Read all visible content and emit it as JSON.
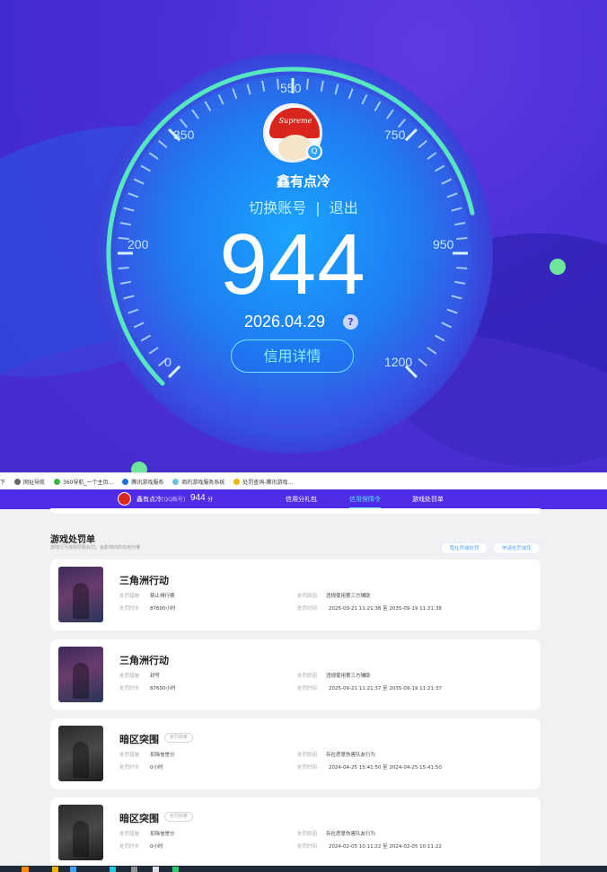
{
  "hero": {
    "username": "鑫有点冷",
    "switch_account": "切换账号",
    "separator": "|",
    "logout": "退出",
    "score": "944",
    "date": "2026.04.29",
    "help": "?",
    "detail_button": "信用详情",
    "avatar_cap_text": "Supreme",
    "gauge_labels": [
      "0",
      "200",
      "350",
      "550",
      "750",
      "950",
      "1200"
    ],
    "gauge_min": 0,
    "gauge_max": 1200,
    "colors": {
      "progress": "#57e7c0",
      "accent": "#6fe3ff",
      "background": "#4a2fd6"
    }
  },
  "bookmarks": [
    {
      "label": "下",
      "icon": "none"
    },
    {
      "label": "网址导航",
      "icon": "globe-icon",
      "color": "#666666"
    },
    {
      "label": "360导航_一个主页...",
      "icon": "360-icon",
      "color": "#3fb449"
    },
    {
      "label": "腾讯游戏服务",
      "icon": "tencent-icon",
      "color": "#1e6fd9"
    },
    {
      "label": "商的游戏服务系统",
      "icon": "service-icon",
      "color": "#6ec3d8"
    },
    {
      "label": "处罚查询-腾讯游戏...",
      "icon": "star-icon",
      "color": "#f5b400"
    }
  ],
  "navbar": {
    "username": "鑫有点冷",
    "account_tag": "[QQ账号]",
    "score": "944",
    "score_unit": "分",
    "tabs": [
      {
        "label": "信用分礼包",
        "active": false
      },
      {
        "label": "信用保障令",
        "active": true
      },
      {
        "label": "游戏处罚单",
        "active": false
      }
    ]
  },
  "penalties": {
    "title": "游戏处罚单",
    "description": "游戏行为违规导致处罚，会影响你的信用分哦",
    "buttons": [
      "我在异端处罚",
      "申请处罚减免"
    ],
    "labels": {
      "measure": "处罚措施",
      "duration": "处罚时长",
      "reason": "处罚原因",
      "time": "处罚时间"
    },
    "time_separator": "至",
    "items": [
      {
        "game": "三角洲行动",
        "tag": "",
        "measure": "禁止排行榜",
        "duration": "87600小时",
        "reason": "违规使用第三方辅助",
        "start": "2025-09-21 11:21:38",
        "end": "2035-09-19 11:21:38",
        "thumb": "purple"
      },
      {
        "game": "三角洲行动",
        "tag": "",
        "measure": "封号",
        "duration": "87600小时",
        "reason": "违规使用第三方辅助",
        "start": "2025-09-21 11:21:37",
        "end": "2035-09-19 11:21:37",
        "thumb": "purple"
      },
      {
        "game": "暗区突围",
        "tag": "处罚结束",
        "measure": "扣除信誉分",
        "duration": "0小时",
        "reason": "存在恶意伤害队友行为",
        "start": "2024-04-25 15:41:50",
        "end": "2024-04-25 15:41:50",
        "thumb": "dark"
      },
      {
        "game": "暗区突围",
        "tag": "处罚结束",
        "measure": "扣除信誉分",
        "duration": "0小时",
        "reason": "存在恶意伤害队友行为",
        "start": "2024-02-05 10:11:22",
        "end": "2024-02-05 10:11:22",
        "thumb": "dark"
      }
    ]
  }
}
